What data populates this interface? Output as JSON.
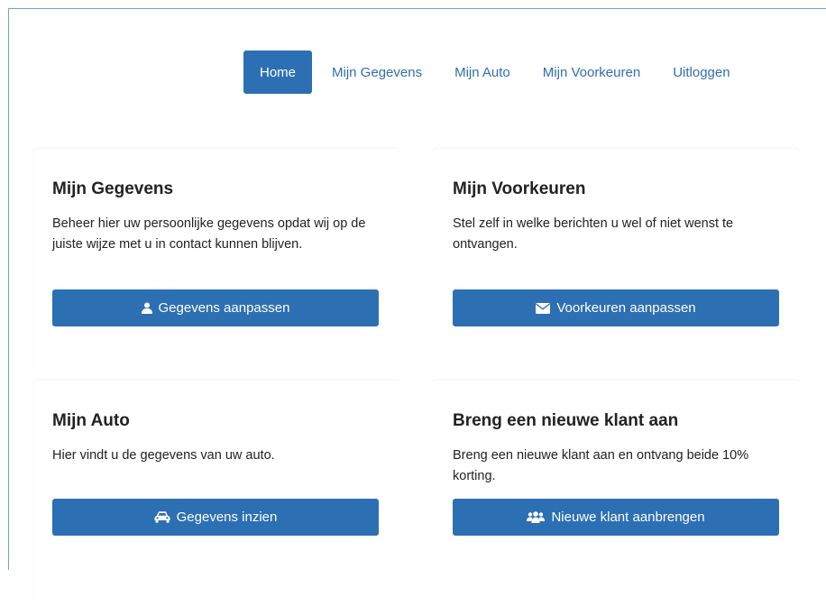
{
  "nav": {
    "items": [
      {
        "label": "Home",
        "active": true
      },
      {
        "label": "Mijn Gegevens",
        "active": false
      },
      {
        "label": "Mijn Auto",
        "active": false
      },
      {
        "label": "Mijn Voorkeuren",
        "active": false
      },
      {
        "label": "Uitloggen",
        "active": false
      }
    ]
  },
  "cards": [
    {
      "title": "Mijn Gegevens",
      "text": "Beheer hier uw persoonlijke gegevens opdat wij op de juiste wijze met u in contact kunnen blijven.",
      "button_label": "Gegevens aanpassen",
      "icon": "user-icon"
    },
    {
      "title": "Mijn Voorkeuren",
      "text": "Stel zelf in welke berichten u wel of niet wenst te ontvangen.",
      "button_label": "Voorkeuren aanpassen",
      "icon": "envelope-icon"
    },
    {
      "title": "Mijn Auto",
      "text": "Hier vindt u de gegevens van uw auto.",
      "button_label": "Gegevens inzien",
      "icon": "car-icon"
    },
    {
      "title": "Breng een nieuwe klant aan",
      "text": "Breng een nieuwe klant aan en ontvang beide 10% korting.",
      "button_label": "Nieuwe klant aanbrengen",
      "icon": "users-icon"
    }
  ],
  "colors": {
    "primary": "#2d6fb3",
    "link": "#2f6fb0",
    "text": "#222222"
  }
}
